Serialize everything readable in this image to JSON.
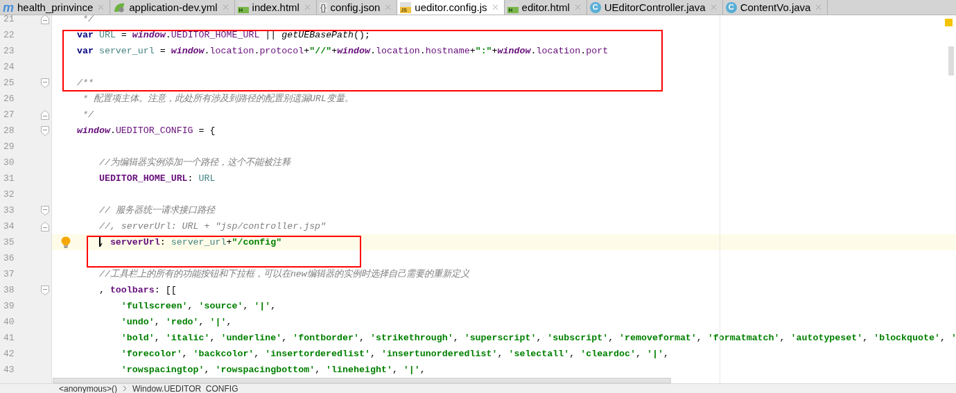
{
  "tabs": [
    {
      "label": "health_prinvince",
      "kind": "maven",
      "icon_label": "m",
      "selected": false
    },
    {
      "label": "application-dev.yml",
      "kind": "spring",
      "selected": false
    },
    {
      "label": "index.html",
      "kind": "html",
      "icon_label": "H",
      "selected": false
    },
    {
      "label": "config.json",
      "kind": "json",
      "icon_label": "{}",
      "selected": false
    },
    {
      "label": "ueditor.config.js",
      "kind": "js",
      "icon_label": "JS",
      "selected": true
    },
    {
      "label": "editor.html",
      "kind": "html",
      "icon_label": "H",
      "selected": false
    },
    {
      "label": "UEditorController.java",
      "kind": "class",
      "icon_label": "C",
      "selected": false
    },
    {
      "label": "ContentVo.java",
      "kind": "class",
      "icon_label": "C",
      "selected": false
    }
  ],
  "editor": {
    "lines": [
      {
        "number": "21",
        "fold_start": false,
        "fold_end": true,
        "current": false,
        "tokens": [
          {
            "text": " */",
            "kind": "comment"
          }
        ]
      },
      {
        "number": "22",
        "fold_start": false,
        "fold_end": false,
        "current": false,
        "tokens": [
          {
            "text": "var",
            "kind": "kw"
          },
          {
            "text": " URL",
            "kind": "ident"
          },
          {
            "text": " = ",
            "kind": "plain"
          },
          {
            "text": "window",
            "kind": "global"
          },
          {
            "text": ".",
            "kind": "plain"
          },
          {
            "text": "UEDITOR_HOME_URL",
            "kind": "prop"
          },
          {
            "text": " || ",
            "kind": "plain"
          },
          {
            "text": "getUEBasePath",
            "kind": "fn"
          },
          {
            "text": "();",
            "kind": "plain"
          }
        ]
      },
      {
        "number": "23",
        "fold_start": false,
        "fold_end": false,
        "current": false,
        "tokens": [
          {
            "text": "var",
            "kind": "kw"
          },
          {
            "text": " server_url",
            "kind": "ident"
          },
          {
            "text": " = ",
            "kind": "plain"
          },
          {
            "text": "window",
            "kind": "global"
          },
          {
            "text": ".",
            "kind": "plain"
          },
          {
            "text": "location",
            "kind": "prop"
          },
          {
            "text": ".",
            "kind": "plain"
          },
          {
            "text": "protocol",
            "kind": "prop"
          },
          {
            "text": "+",
            "kind": "plain"
          },
          {
            "text": "\"//\"",
            "kind": "str"
          },
          {
            "text": "+",
            "kind": "plain"
          },
          {
            "text": "window",
            "kind": "global"
          },
          {
            "text": ".",
            "kind": "plain"
          },
          {
            "text": "location",
            "kind": "prop"
          },
          {
            "text": ".",
            "kind": "plain"
          },
          {
            "text": "hostname",
            "kind": "prop"
          },
          {
            "text": "+",
            "kind": "plain"
          },
          {
            "text": "\":\"",
            "kind": "str"
          },
          {
            "text": "+",
            "kind": "plain"
          },
          {
            "text": "window",
            "kind": "global"
          },
          {
            "text": ".",
            "kind": "plain"
          },
          {
            "text": "location",
            "kind": "prop"
          },
          {
            "text": ".",
            "kind": "plain"
          },
          {
            "text": "port",
            "kind": "prop"
          }
        ]
      },
      {
        "number": "24",
        "fold_start": false,
        "fold_end": false,
        "current": false
      },
      {
        "number": "25",
        "fold_start": true,
        "fold_end": false,
        "current": false,
        "tokens": [
          {
            "text": "/**",
            "kind": "comment"
          }
        ]
      },
      {
        "number": "26",
        "fold_start": false,
        "fold_end": false,
        "current": false,
        "tokens": [
          {
            "text": " * 配置项主体。注意，此处所有涉及到路径的配置别遗漏URL变量。",
            "kind": "comment"
          }
        ]
      },
      {
        "number": "27",
        "fold_start": false,
        "fold_end": true,
        "current": false,
        "tokens": [
          {
            "text": " */",
            "kind": "comment"
          }
        ]
      },
      {
        "number": "28",
        "fold_start": true,
        "fold_end": false,
        "current": false,
        "tokens": [
          {
            "text": "window",
            "kind": "global"
          },
          {
            "text": ".",
            "kind": "plain"
          },
          {
            "text": "UEDITOR_CONFIG",
            "kind": "prop"
          },
          {
            "text": " = {",
            "kind": "plain"
          }
        ]
      },
      {
        "number": "29",
        "fold_start": false,
        "fold_end": false,
        "current": false
      },
      {
        "number": "30",
        "fold_start": false,
        "fold_end": false,
        "current": false,
        "tokens": [
          {
            "text": "    //为编辑器实例添加一个路径，这个不能被注释",
            "kind": "comment"
          }
        ]
      },
      {
        "number": "31",
        "fold_start": false,
        "fold_end": false,
        "current": false,
        "tokens": [
          {
            "text": "    UEDITOR_HOME_URL",
            "kind": "propbold"
          },
          {
            "text": ": ",
            "kind": "plain"
          },
          {
            "text": "URL",
            "kind": "ident"
          }
        ]
      },
      {
        "number": "32",
        "fold_start": false,
        "fold_end": false,
        "current": false
      },
      {
        "number": "33",
        "fold_start": true,
        "fold_end": false,
        "current": false,
        "tokens": [
          {
            "text": "    // 服务器统一请求接口路径",
            "kind": "comment"
          }
        ]
      },
      {
        "number": "34",
        "fold_start": false,
        "fold_end": true,
        "current": false,
        "tokens": [
          {
            "text": "    //, serverUrl: URL + \"jsp/controller.jsp\"",
            "kind": "comment"
          }
        ]
      },
      {
        "number": "35",
        "fold_start": false,
        "fold_end": false,
        "current": true,
        "tokens": [
          {
            "text": "    , ",
            "kind": "plain"
          },
          {
            "text": "serverUrl",
            "kind": "propbold"
          },
          {
            "text": ": ",
            "kind": "plain"
          },
          {
            "text": "server_url",
            "kind": "ident"
          },
          {
            "text": "+",
            "kind": "plain"
          },
          {
            "text": "\"/config\"",
            "kind": "str"
          }
        ]
      },
      {
        "number": "36",
        "fold_start": false,
        "fold_end": false,
        "current": false
      },
      {
        "number": "37",
        "fold_start": false,
        "fold_end": false,
        "current": false,
        "tokens": [
          {
            "text": "    //工具栏上的所有的功能按钮和下拉框，可以在new编辑器的实例时选择自己需要的重新定义",
            "kind": "comment"
          }
        ]
      },
      {
        "number": "38",
        "fold_start": true,
        "fold_end": false,
        "current": false,
        "tokens": [
          {
            "text": "    , ",
            "kind": "plain"
          },
          {
            "text": "toolbars",
            "kind": "propbold"
          },
          {
            "text": ": [[",
            "kind": "plain"
          }
        ]
      },
      {
        "number": "39",
        "fold_start": false,
        "fold_end": false,
        "current": false,
        "tokens": [
          {
            "text": "        'fullscreen'",
            "kind": "str"
          },
          {
            "text": ", ",
            "kind": "plain"
          },
          {
            "text": "'source'",
            "kind": "str"
          },
          {
            "text": ", ",
            "kind": "plain"
          },
          {
            "text": "'|'",
            "kind": "str"
          },
          {
            "text": ",",
            "kind": "plain"
          }
        ]
      },
      {
        "number": "40",
        "fold_start": false,
        "fold_end": false,
        "current": false,
        "tokens": [
          {
            "text": "        'undo'",
            "kind": "str"
          },
          {
            "text": ", ",
            "kind": "plain"
          },
          {
            "text": "'redo'",
            "kind": "str"
          },
          {
            "text": ", ",
            "kind": "plain"
          },
          {
            "text": "'|'",
            "kind": "str"
          },
          {
            "text": ",",
            "kind": "plain"
          }
        ]
      },
      {
        "number": "41",
        "fold_start": false,
        "fold_end": false,
        "current": false,
        "tokens": [
          {
            "text": "        'bold'",
            "kind": "str"
          },
          {
            "text": ", ",
            "kind": "plain"
          },
          {
            "text": "'italic'",
            "kind": "str"
          },
          {
            "text": ", ",
            "kind": "plain"
          },
          {
            "text": "'underline'",
            "kind": "str"
          },
          {
            "text": ", ",
            "kind": "plain"
          },
          {
            "text": "'fontborder'",
            "kind": "str"
          },
          {
            "text": ", ",
            "kind": "plain"
          },
          {
            "text": "'strikethrough'",
            "kind": "str"
          },
          {
            "text": ", ",
            "kind": "plain"
          },
          {
            "text": "'superscript'",
            "kind": "str"
          },
          {
            "text": ", ",
            "kind": "plain"
          },
          {
            "text": "'subscript'",
            "kind": "str"
          },
          {
            "text": ", ",
            "kind": "plain"
          },
          {
            "text": "'removeformat'",
            "kind": "str"
          },
          {
            "text": ", ",
            "kind": "plain"
          },
          {
            "text": "'formatmatch'",
            "kind": "str"
          },
          {
            "text": ", ",
            "kind": "plain"
          },
          {
            "text": "'autotypeset'",
            "kind": "str"
          },
          {
            "text": ", ",
            "kind": "plain"
          },
          {
            "text": "'blockquote'",
            "kind": "str"
          },
          {
            "text": ", ",
            "kind": "plain"
          },
          {
            "text": "'",
            "kind": "str"
          }
        ]
      },
      {
        "number": "42",
        "fold_start": false,
        "fold_end": false,
        "current": false,
        "tokens": [
          {
            "text": "        'forecolor'",
            "kind": "str"
          },
          {
            "text": ", ",
            "kind": "plain"
          },
          {
            "text": "'backcolor'",
            "kind": "str"
          },
          {
            "text": ", ",
            "kind": "plain"
          },
          {
            "text": "'insertorderedlist'",
            "kind": "str"
          },
          {
            "text": ", ",
            "kind": "plain"
          },
          {
            "text": "'insertunorderedlist'",
            "kind": "str"
          },
          {
            "text": ", ",
            "kind": "plain"
          },
          {
            "text": "'selectall'",
            "kind": "str"
          },
          {
            "text": ", ",
            "kind": "plain"
          },
          {
            "text": "'cleardoc'",
            "kind": "str"
          },
          {
            "text": ", ",
            "kind": "plain"
          },
          {
            "text": "'|'",
            "kind": "str"
          },
          {
            "text": ",",
            "kind": "plain"
          }
        ]
      },
      {
        "number": "43",
        "fold_start": false,
        "fold_end": false,
        "current": false,
        "tokens": [
          {
            "text": "        'rowspacingtop'",
            "kind": "str"
          },
          {
            "text": ", ",
            "kind": "plain"
          },
          {
            "text": "'rowspacingbottom'",
            "kind": "str"
          },
          {
            "text": ", ",
            "kind": "plain"
          },
          {
            "text": "'lineheight'",
            "kind": "str"
          },
          {
            "text": ", ",
            "kind": "plain"
          },
          {
            "text": "'|'",
            "kind": "str"
          },
          {
            "text": ",",
            "kind": "plain"
          }
        ]
      }
    ]
  },
  "breadcrumb": [
    "<anonymous>()",
    "Window.UEDITOR_CONFIG"
  ]
}
